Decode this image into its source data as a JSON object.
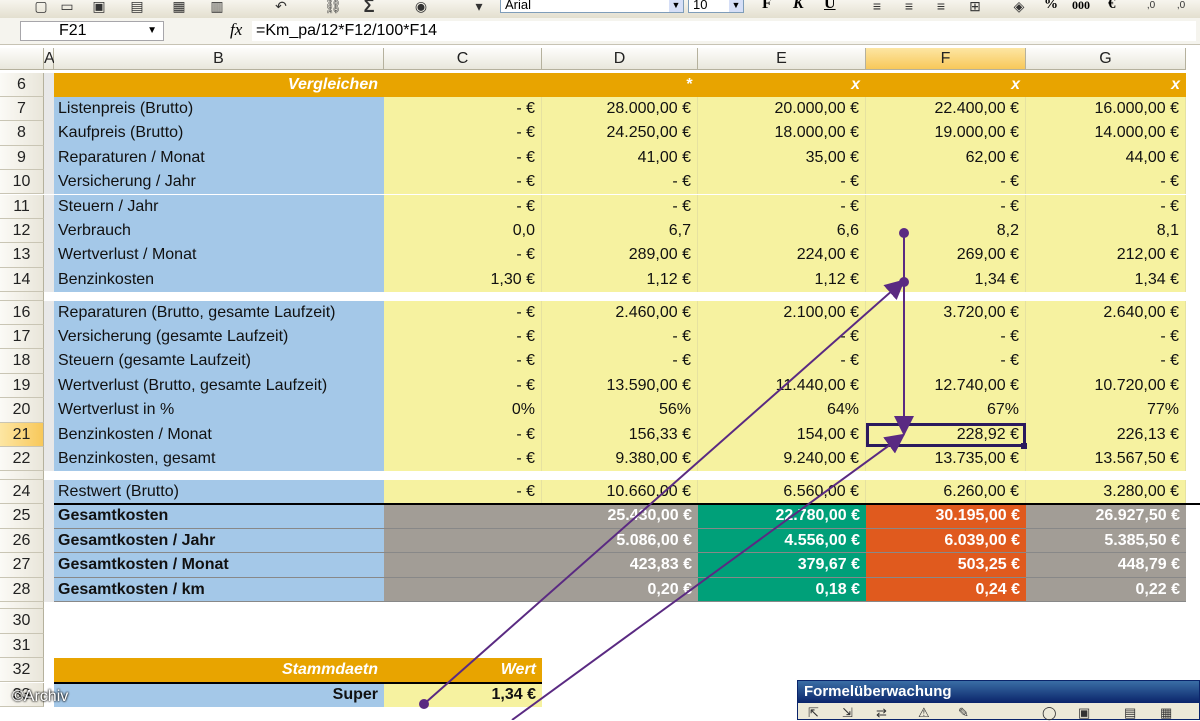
{
  "toolbar": {
    "font_name": "Arial",
    "font_size": "10",
    "format_buttons": [
      "F",
      "K",
      "U"
    ],
    "percent": "%",
    "thousands": "000",
    "euro": "€"
  },
  "formula_bar": {
    "name_box": "F21",
    "fx": "fx",
    "formula": "=Km_pa/12*F12/100*F14"
  },
  "columns": [
    "A",
    "B",
    "C",
    "D",
    "E",
    "F",
    "G"
  ],
  "selected_column": "F",
  "selected_row": "21",
  "rows": [
    {
      "n": "6",
      "b": "Vergleichen",
      "c": "",
      "d": "*",
      "e": "x",
      "f": "x",
      "g": "x"
    },
    {
      "n": "7",
      "b": "Listenpreis (Brutto)",
      "c": "-   €",
      "d": "28.000,00 €",
      "e": "20.000,00 €",
      "f": "22.400,00 €",
      "g": "16.000,00 €"
    },
    {
      "n": "8",
      "b": "Kaufpreis (Brutto)",
      "c": "-   €",
      "d": "24.250,00 €",
      "e": "18.000,00 €",
      "f": "19.000,00 €",
      "g": "14.000,00 €"
    },
    {
      "n": "9",
      "b": "Reparaturen / Monat",
      "c": "-   €",
      "d": "41,00 €",
      "e": "35,00 €",
      "f": "62,00 €",
      "g": "44,00 €"
    },
    {
      "n": "10",
      "b": "Versicherung / Jahr",
      "c": "-   €",
      "d": "-   €",
      "e": "-   €",
      "f": "-   €",
      "g": "-   €"
    },
    {
      "n": "11",
      "b": "Steuern / Jahr",
      "c": "-   €",
      "d": "-   €",
      "e": "-   €",
      "f": "-   €",
      "g": "-   €"
    },
    {
      "n": "12",
      "b": "Verbrauch",
      "c": "0,0",
      "d": "6,7",
      "e": "6,6",
      "f": "8,2",
      "g": "8,1"
    },
    {
      "n": "13",
      "b": "Wertverlust / Monat",
      "c": "-   €",
      "d": "289,00 €",
      "e": "224,00 €",
      "f": "269,00 €",
      "g": "212,00 €"
    },
    {
      "n": "14",
      "b": "Benzinkosten",
      "c": "1,30 €",
      "d": "1,12 €",
      "e": "1,12 €",
      "f": "1,34 €",
      "g": "1,34 €"
    },
    {
      "n": "16",
      "b": "Reparaturen (Brutto, gesamte Laufzeit)",
      "c": "-   €",
      "d": "2.460,00 €",
      "e": "2.100,00 €",
      "f": "3.720,00 €",
      "g": "2.640,00 €"
    },
    {
      "n": "17",
      "b": "Versicherung (gesamte Laufzeit)",
      "c": "-   €",
      "d": "-   €",
      "e": "-   €",
      "f": "-   €",
      "g": "-   €"
    },
    {
      "n": "18",
      "b": "Steuern (gesamte Laufzeit)",
      "c": "-   €",
      "d": "-   €",
      "e": "-   €",
      "f": "-   €",
      "g": "-   €"
    },
    {
      "n": "19",
      "b": "Wertverlust (Brutto, gesamte Laufzeit)",
      "c": "-   €",
      "d": "13.590,00 €",
      "e": "11.440,00 €",
      "f": "12.740,00 €",
      "g": "10.720,00 €"
    },
    {
      "n": "20",
      "b": "Wertverlust in %",
      "c": "0%",
      "d": "56%",
      "e": "64%",
      "f": "67%",
      "g": "77%"
    },
    {
      "n": "21",
      "b": "Benzinkosten / Monat",
      "c": "-   €",
      "d": "156,33 €",
      "e": "154,00 €",
      "f": "228,92 €",
      "g": "226,13 €"
    },
    {
      "n": "22",
      "b": "Benzinkosten, gesamt",
      "c": "-   €",
      "d": "9.380,00 €",
      "e": "9.240,00 €",
      "f": "13.735,00 €",
      "g": "13.567,50 €"
    },
    {
      "n": "24",
      "b": "Restwert (Brutto)",
      "c": "-   €",
      "d": "10.660,00 €",
      "e": "6.560,00 €",
      "f": "6.260,00 €",
      "g": "3.280,00 €"
    },
    {
      "n": "25",
      "b": "Gesamtkosten",
      "c": "",
      "d": "25.430,00 €",
      "e": "22.780,00 €",
      "f": "30.195,00 €",
      "g": "26.927,50 €"
    },
    {
      "n": "26",
      "b": "Gesamtkosten / Jahr",
      "c": "",
      "d": "5.086,00 €",
      "e": "4.556,00 €",
      "f": "6.039,00 €",
      "g": "5.385,50 €"
    },
    {
      "n": "27",
      "b": "Gesamtkosten / Monat",
      "c": "",
      "d": "423,83 €",
      "e": "379,67 €",
      "f": "503,25 €",
      "g": "448,79 €"
    },
    {
      "n": "28",
      "b": "Gesamtkosten / km",
      "c": "",
      "d": "0,20 €",
      "e": "0,18 €",
      "f": "0,24 €",
      "g": "0,22 €"
    },
    {
      "n": "30",
      "b": "",
      "c": "",
      "d": "",
      "e": "",
      "f": "",
      "g": ""
    },
    {
      "n": "31",
      "b": "",
      "c": "",
      "d": "",
      "e": "",
      "f": "",
      "g": ""
    },
    {
      "n": "32",
      "b": "Stammdaetn",
      "c": "Wert",
      "d": "",
      "e": "",
      "f": "",
      "g": ""
    },
    {
      "n": "33",
      "b": "Super",
      "c": "1,34 €",
      "d": "",
      "e": "",
      "f": "",
      "g": ""
    }
  ],
  "colors": {
    "header_orange": "#e8a400",
    "label_blue": "#a4c8e8",
    "cell_yellow": "#f6f2a0",
    "total_gray": "#a29d96",
    "total_green": "#00a079",
    "total_red": "#e05a1e",
    "arrow_purple": "#5a2a82"
  },
  "watermark": "©Archiv",
  "watch_window": {
    "title": "Formelüberwachung"
  }
}
